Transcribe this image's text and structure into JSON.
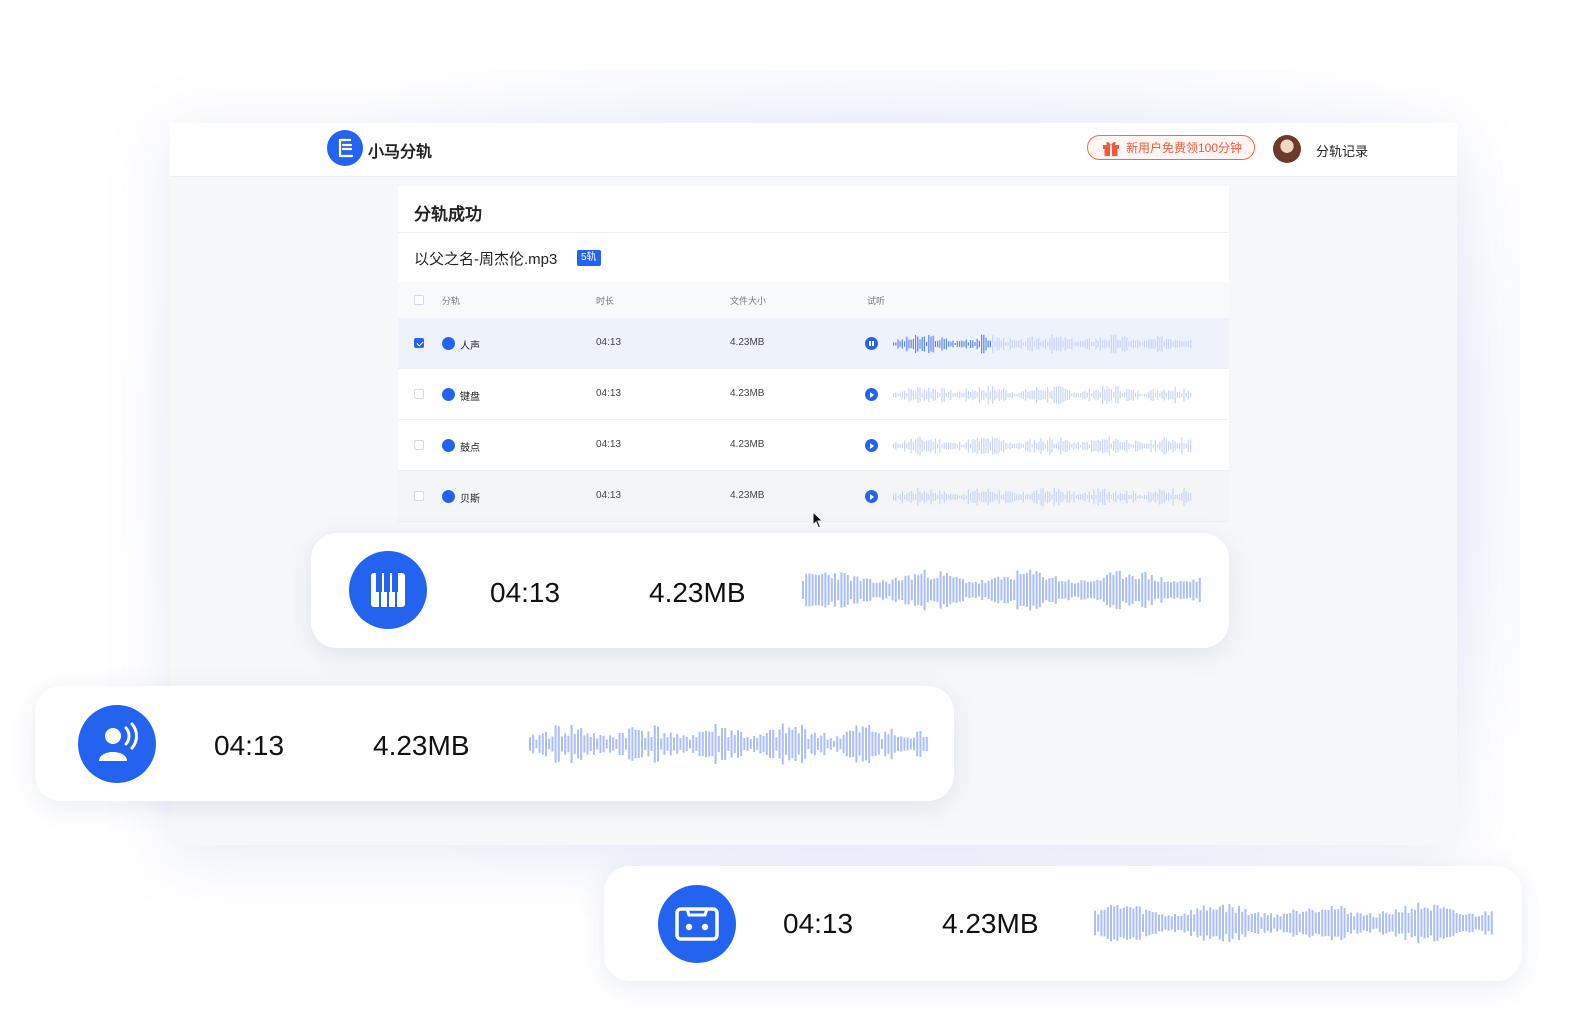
{
  "app": {
    "title": "小马分轨",
    "logo_icon": "app-logo-icon",
    "accent_color": "#2463f0"
  },
  "header": {
    "promo_label": "新用户免费领100分钟",
    "promo_icon": "gift-icon",
    "history_label": "分轨记录"
  },
  "panel": {
    "title": "分轨成功",
    "file_name": "以父之名-周杰伦.mp3",
    "track_badge": "5轨",
    "columns": {
      "track": "分轨",
      "duration": "时长",
      "size": "文件大小",
      "preview": "试听"
    },
    "rows": [
      {
        "name": "人声",
        "icon": "vocal-icon",
        "duration": "04:13",
        "size": "4.23MB",
        "checked": true,
        "playing": true
      },
      {
        "name": "键盘",
        "icon": "keyboard-icon",
        "duration": "04:13",
        "size": "4.23MB",
        "checked": false,
        "playing": false
      },
      {
        "name": "鼓点",
        "icon": "drum-icon",
        "duration": "04:13",
        "size": "4.23MB",
        "checked": false,
        "playing": false
      },
      {
        "name": "贝斯",
        "icon": "bass-icon",
        "duration": "04:13",
        "size": "4.23MB",
        "checked": false,
        "playing": false
      }
    ]
  },
  "cards": [
    {
      "icon": "piano-icon",
      "duration": "04:13",
      "size": "4.23MB"
    },
    {
      "icon": "vocal-icon",
      "duration": "04:13",
      "size": "4.23MB"
    },
    {
      "icon": "cassette-icon",
      "duration": "04:13",
      "size": "4.23MB"
    }
  ]
}
